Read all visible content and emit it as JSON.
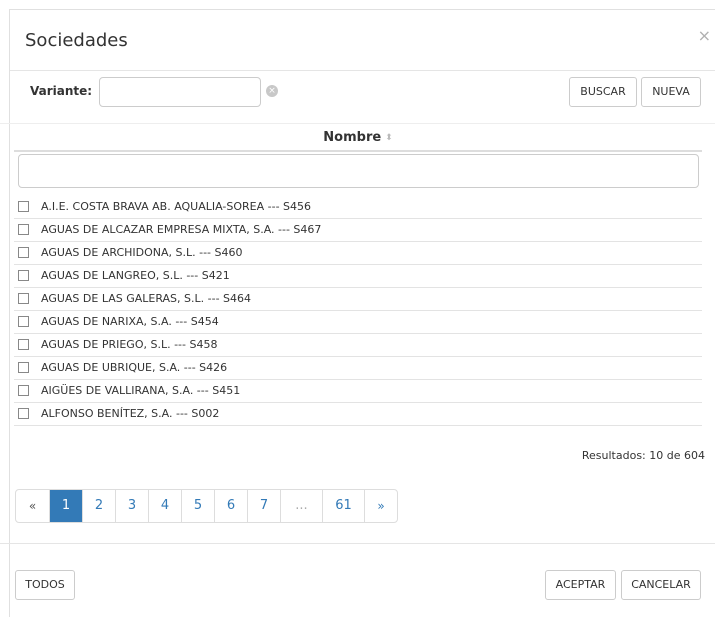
{
  "dialog": {
    "title": "Sociedades",
    "close_symbol": "×"
  },
  "search": {
    "variante_label": "Variante:",
    "variante_value": "",
    "buscar_label": "BUSCAR",
    "nueva_label": "NUEVA"
  },
  "table": {
    "column_header": "Nombre",
    "sort_symbol": "⬍",
    "filter_value": "",
    "rows": [
      "A.I.E. COSTA BRAVA AB. AQUALIA-SOREA --- S456",
      "AGUAS DE ALCAZAR EMPRESA MIXTA, S.A. --- S467",
      "AGUAS DE ARCHIDONA, S.L. --- S460",
      "AGUAS DE LANGREO, S.L. --- S421",
      "AGUAS DE LAS GALERAS, S.L. --- S464",
      "AGUAS DE NARIXA, S.A. --- S454",
      "AGUAS DE PRIEGO, S.L. --- S458",
      "AGUAS DE UBRIQUE, S.A. --- S426",
      "AIGÜES DE VALLIRANA, S.A. --- S451",
      "ALFONSO BENÍTEZ, S.A. --- S002"
    ],
    "results_text": "Resultados: 10 de 604"
  },
  "pagination": {
    "prev": "«",
    "pages": [
      "1",
      "2",
      "3",
      "4",
      "5",
      "6",
      "7"
    ],
    "ellipsis": "...",
    "last": "61",
    "next": "»",
    "active_page": "1"
  },
  "footer": {
    "todos_label": "TODOS",
    "aceptar_label": "ACEPTAR",
    "cancelar_label": "CANCELAR"
  },
  "colors": {
    "accent": "#337ab7",
    "border": "#cccccc"
  }
}
